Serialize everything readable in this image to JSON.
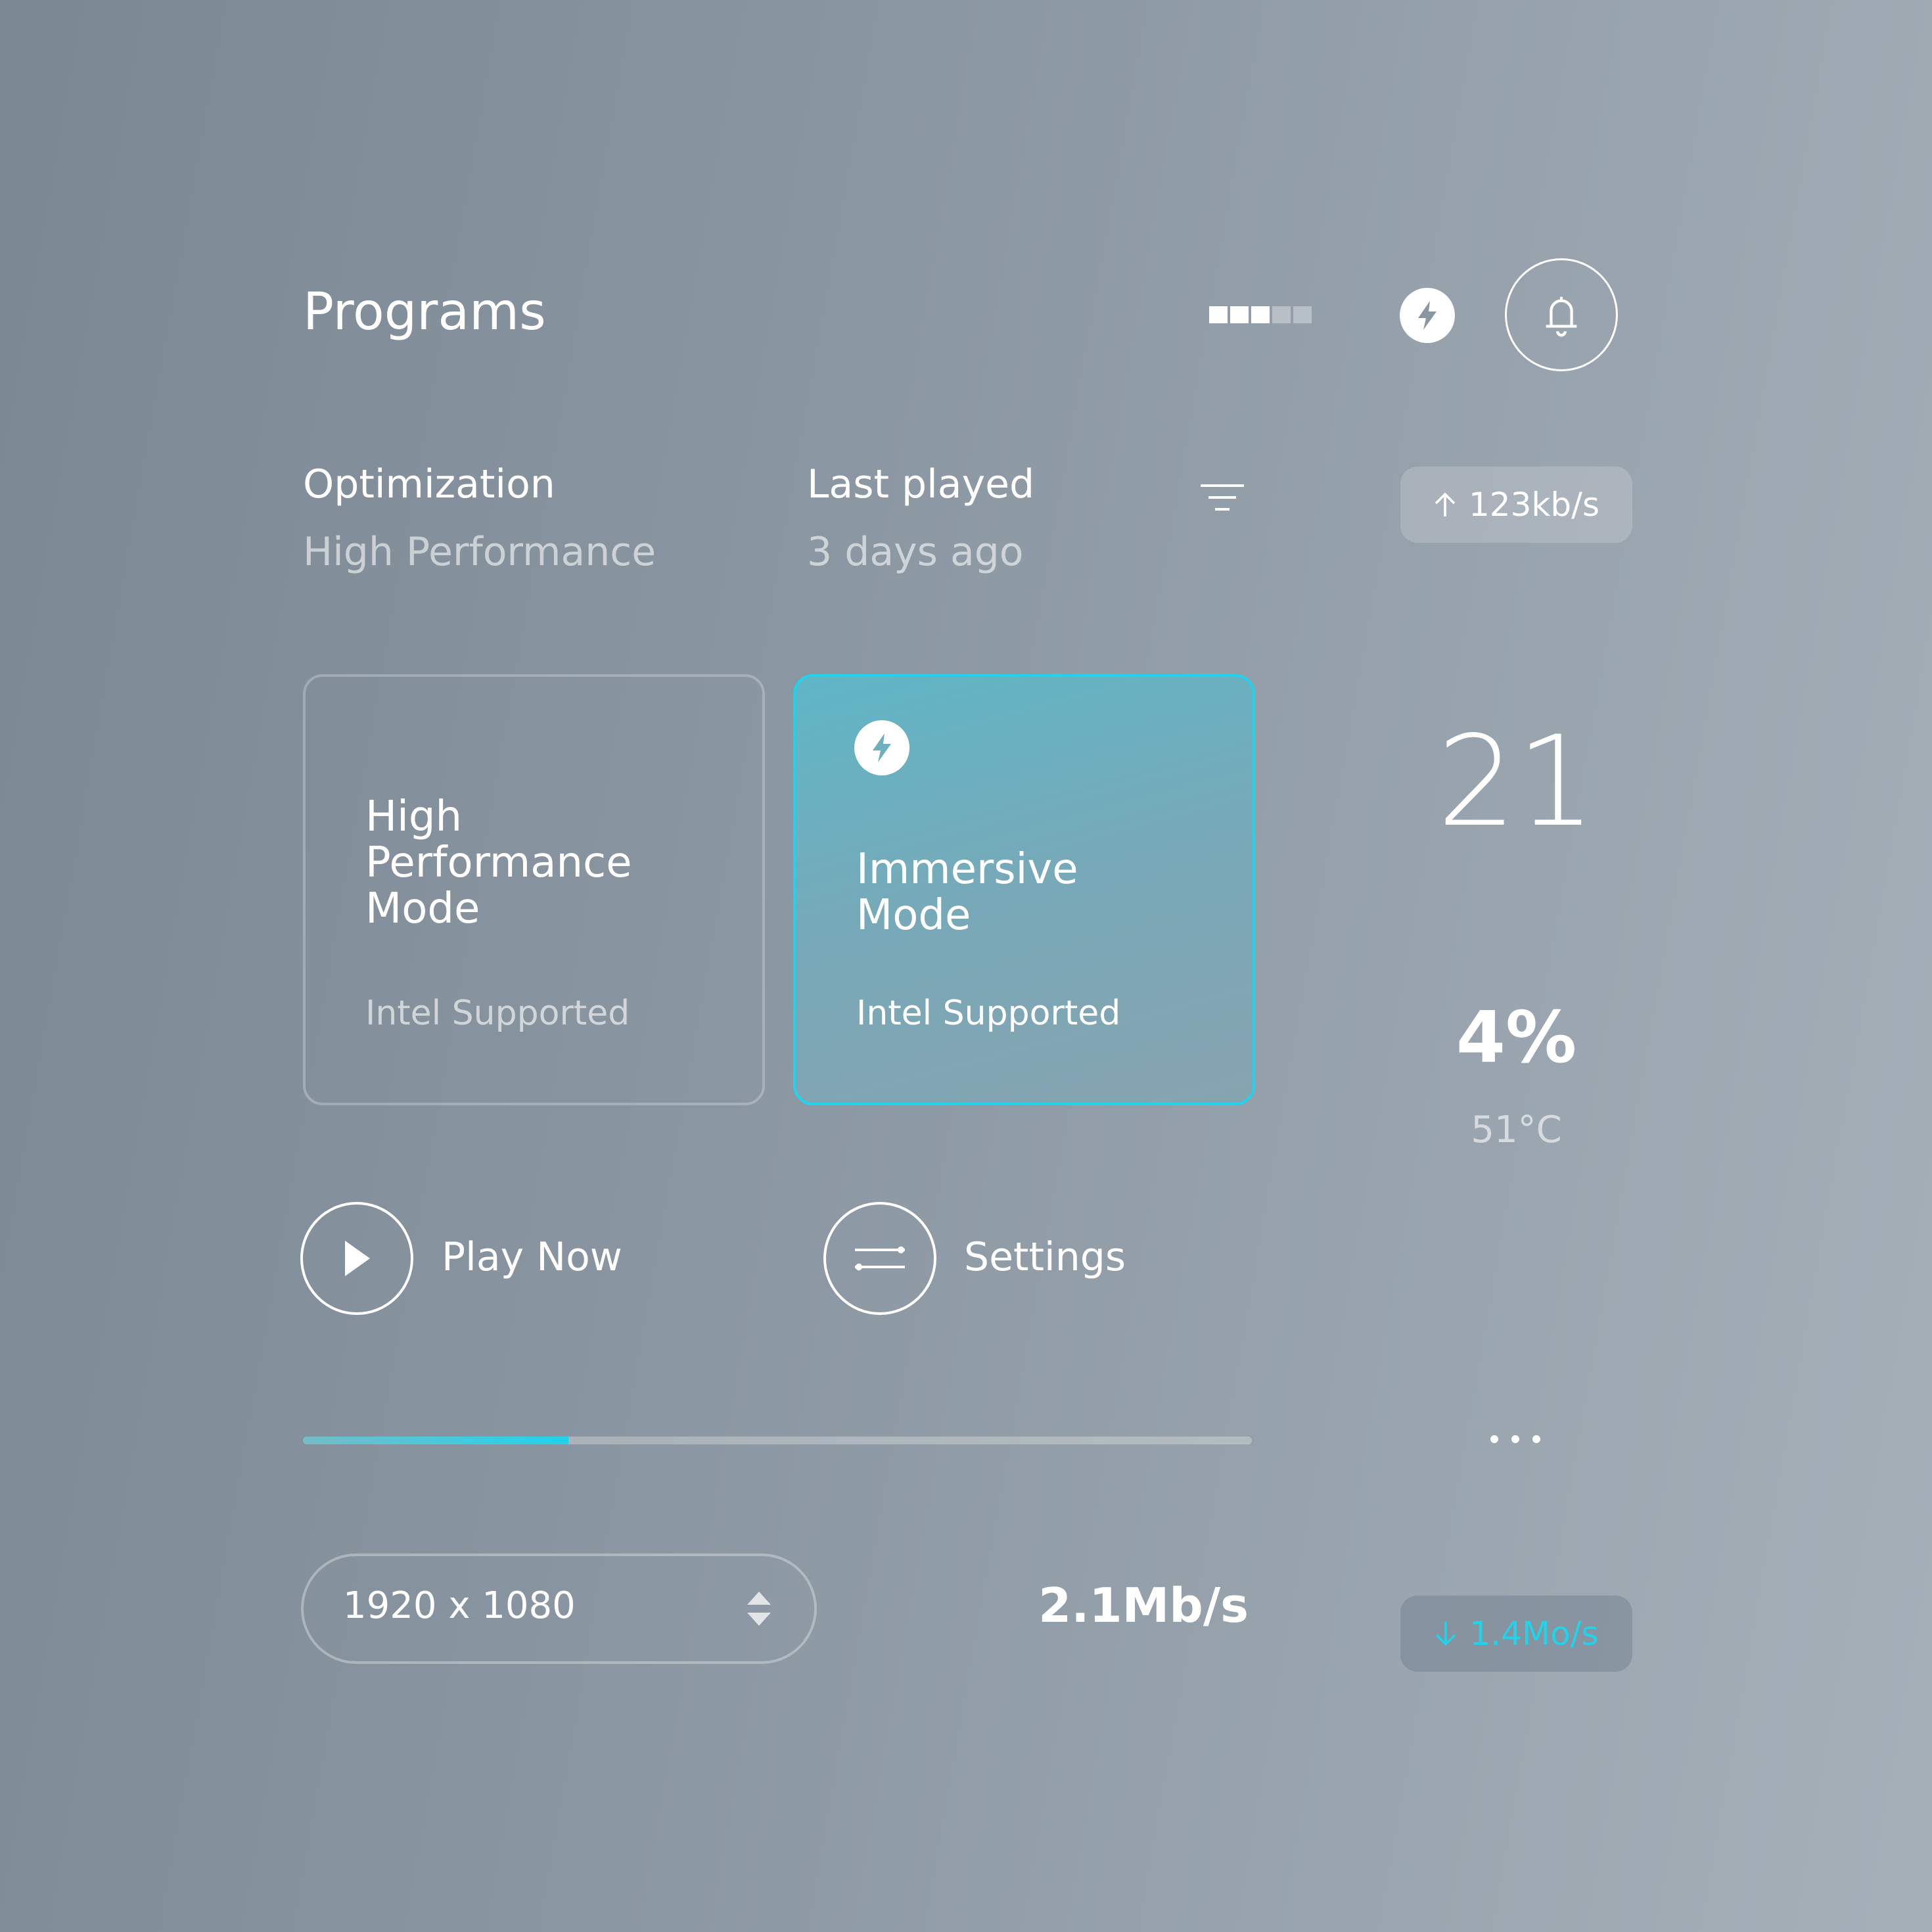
{
  "header": {
    "title": "Programs",
    "signal_bars": [
      true,
      true,
      true,
      false,
      false
    ],
    "icons": {
      "signal": "signal-strength-icon",
      "power": "bolt-icon",
      "notifications": "bell-icon"
    }
  },
  "info": {
    "optimization_label": "Optimization",
    "optimization_value": "High Performance",
    "last_played_label": "Last played",
    "last_played_value": "3 days ago",
    "filter_icon": "filter-icon"
  },
  "network": {
    "upload": "123kb/s",
    "upload_icon": "arrow-up-icon",
    "download": "1.4Mo/s",
    "download_icon": "arrow-down-icon"
  },
  "modes": [
    {
      "title": "High\nPerformance\nMode",
      "subtitle": "Intel Supported",
      "selected": false
    },
    {
      "title": "Immersive\nMode",
      "subtitle": "Intel Supported",
      "selected": true,
      "icon": "bolt-icon"
    }
  ],
  "stats": {
    "count": "21",
    "percent": "4%",
    "temperature": "51°C"
  },
  "actions": {
    "play_label": "Play Now",
    "settings_label": "Settings"
  },
  "progress": {
    "value": 0.28
  },
  "resolution": {
    "value": "1920 x 1080"
  },
  "speed": "2.1Mb/s",
  "colors": {
    "accent": "#1fd3ea",
    "text": "#ffffff",
    "muted_text": "#c9d0d6",
    "background_start": "#7b8893",
    "background_end": "#a6b0b9"
  }
}
